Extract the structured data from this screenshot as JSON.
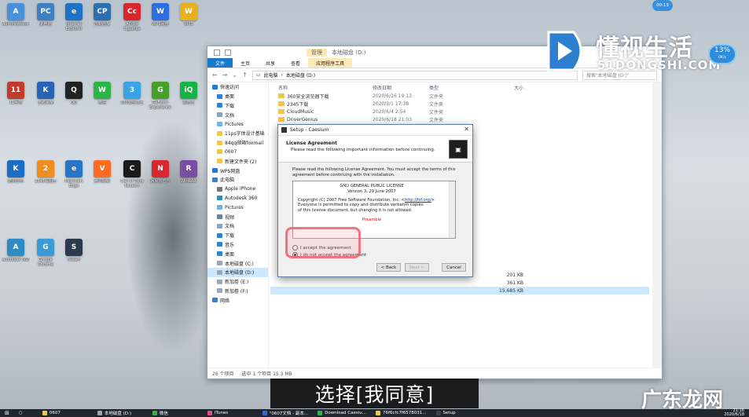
{
  "desktop": {
    "icons": [
      {
        "label": "Administrator",
        "icon": "user-folder-icon",
        "color": "#4a90d9",
        "text": "A"
      },
      {
        "label": "此电脑",
        "icon": "computer-icon",
        "color": "#3f7fc4",
        "text": "PC"
      },
      {
        "label": "Internet Explorer",
        "icon": "ie-icon",
        "color": "#1e73c8",
        "text": "e"
      },
      {
        "label": "控制面板",
        "icon": "control-panel-icon",
        "color": "#2e6fb0",
        "text": "CP"
      },
      {
        "label": "Adobe Creative Cloud",
        "icon": "adobe-cc-icon",
        "color": "#d9242c",
        "text": "Cc"
      },
      {
        "label": "WPS网盘",
        "icon": "wps-cloud-icon",
        "color": "#2d6fe0",
        "text": "W"
      },
      {
        "label": "WPS",
        "icon": "wps-icon",
        "color": "#e8b01c",
        "text": "W"
      },
      {
        "label": "11手游",
        "icon": "game-icon",
        "color": "#c23a2b",
        "text": "11"
      },
      {
        "label": "王者荣耀",
        "icon": "game-icon",
        "color": "#2764b6",
        "text": "K"
      },
      {
        "label": "QQ",
        "icon": "qq-icon",
        "color": "#222222",
        "text": "Q"
      },
      {
        "label": "微信",
        "icon": "wechat-icon",
        "color": "#2db545",
        "text": "W"
      },
      {
        "label": "360安全卫士",
        "icon": "security-icon",
        "color": "#3aa3e6",
        "text": "3"
      },
      {
        "label": "GeForce Experience",
        "icon": "nvidia-icon",
        "color": "#46a12b",
        "text": "G"
      },
      {
        "label": "爱奇艺",
        "icon": "iqiyi-icon",
        "color": "#17b445",
        "text": "iQ"
      },
      {
        "label": "酷狗音乐",
        "icon": "kugou-icon",
        "color": "#1a6ec6",
        "text": "K"
      },
      {
        "label": "2345看图王",
        "icon": "photo-icon",
        "color": "#ef8c22",
        "text": "2"
      },
      {
        "label": "Microsoft Edge",
        "icon": "edge-icon",
        "color": "#2874c6",
        "text": "e"
      },
      {
        "label": "腾讯视频",
        "icon": "video-icon",
        "color": "#ff6c21",
        "text": "V"
      },
      {
        "label": "Call of Duty Modern",
        "icon": "game-icon",
        "color": "#1b1b1b",
        "text": "C"
      },
      {
        "label": "网易云音乐",
        "icon": "netease-music-icon",
        "color": "#d8272e",
        "text": "N"
      },
      {
        "label": "WinRAR",
        "icon": "winrar-icon",
        "color": "#7a4da1",
        "text": "R"
      },
      {
        "label": "Autodesk 360",
        "icon": "autodesk-icon",
        "color": "#2d8cc4",
        "text": "A"
      },
      {
        "label": "Google Chrome",
        "icon": "chrome-icon",
        "color": "#3a9bd6",
        "text": "G"
      },
      {
        "label": "Steam",
        "icon": "steam-icon",
        "color": "#2b3a4d",
        "text": "S"
      }
    ]
  },
  "explorer": {
    "tabs": {
      "file": "文件",
      "home": "主页",
      "share": "共享",
      "view": "查看",
      "app_tools": "应用程序工具",
      "manage": "管理",
      "drive": "本地磁盘 (D:)"
    },
    "breadcrumb": {
      "root": "此电脑",
      "drive": "本地磁盘 (D:)"
    },
    "search_placeholder": "搜索\"本地磁盘 (D:)\"",
    "columns": {
      "name": "名称",
      "date": "修改日期",
      "type": "类型",
      "size": "大小"
    },
    "sidebar": [
      {
        "label": "快速访问",
        "color": "#1e7bd6",
        "sec": true
      },
      {
        "label": "桌面",
        "color": "#2b84d8"
      },
      {
        "label": "下载",
        "color": "#2b84d8"
      },
      {
        "label": "文档",
        "color": "#8aa4c0"
      },
      {
        "label": "Pictures",
        "color": "#6fb4e8"
      },
      {
        "label": "11ps字体设计基础",
        "color": "#f2c54b"
      },
      {
        "label": "84qq邮箱foxmail",
        "color": "#f2c54b"
      },
      {
        "label": "0607",
        "color": "#f2c54b"
      },
      {
        "label": "新建文件夹 (2)",
        "color": "#f2c54b"
      },
      {
        "label": "WPS网盘",
        "color": "#2d6fe0",
        "sec": true
      },
      {
        "label": "此电脑",
        "color": "#3f7fc4",
        "sec": true
      },
      {
        "label": "Apple iPhone",
        "color": "#777777"
      },
      {
        "label": "Autodesk 360",
        "color": "#2d8cc4"
      },
      {
        "label": "Pictures",
        "color": "#6fb4e8"
      },
      {
        "label": "视频",
        "color": "#6b7fa0"
      },
      {
        "label": "文档",
        "color": "#8aa4c0"
      },
      {
        "label": "下载",
        "color": "#2b84d8"
      },
      {
        "label": "音乐",
        "color": "#2b84d8"
      },
      {
        "label": "桌面",
        "color": "#2b84d8"
      },
      {
        "label": "本地磁盘 (C:)",
        "color": "#9aa7b4"
      },
      {
        "label": "本地磁盘 (D:)",
        "color": "#9aa7b4",
        "sel": true
      },
      {
        "label": "新加卷 (E:)",
        "color": "#9aa7b4"
      },
      {
        "label": "新加卷 (F:)",
        "color": "#9aa7b4"
      },
      {
        "label": "网络",
        "color": "#3f7fc4",
        "sec": true
      }
    ],
    "files": [
      {
        "name": "360安全浏览器下载",
        "date": "2020/6/16 19:13",
        "type": "文件夹",
        "size": ""
      },
      {
        "name": "2345下载",
        "date": "2020/3/1 17:38",
        "type": "文件夹",
        "size": ""
      },
      {
        "name": "CloudMusic",
        "date": "2020/6/4 2:54",
        "type": "文件夹",
        "size": ""
      },
      {
        "name": "DriverGenius",
        "date": "2020/6/18 21:03",
        "type": "文件夹",
        "size": ""
      }
    ],
    "hidden_rows": [
      {
        "size": "201 KB"
      },
      {
        "size": "361 KB"
      },
      {
        "size": "15,685 KB",
        "sel": true
      }
    ],
    "status": {
      "count": "26 个项目",
      "selected": "选中 1 个项目 15.3 MB"
    }
  },
  "setup": {
    "title": "Setup - Caesium",
    "close_glyph": "✕",
    "header_title": "License Agreement",
    "header_sub": "Please read the following important information before continuing.",
    "desc": "Please read the following License Agreement. You must accept the terms of this agreement before continuing with the installation.",
    "license_lines": {
      "l1": "GNU GENERAL PUBLIC LICENSE",
      "l2": "Version 3, 29 June 2007",
      "l3a": "Copyright (C) 2007 Free Software Foundation, Inc. <",
      "l3link": "http://fsf.org/",
      "l3b": ">",
      "l4": "Everyone is permitted to copy and distribute verbatim copies",
      "l5": "of this license document, but changing it is not allowed.",
      "preamble": "Preamble"
    },
    "radio_accept": "I accept the agreement",
    "radio_decline": "I do not accept the agreement",
    "btn_back": "< Back",
    "btn_next": "Next >",
    "btn_cancel": "Cancel"
  },
  "watermark": {
    "brand_cn": "懂视生活",
    "brand_en": "51DONGSHI.COM",
    "bottom_brand": "广东龙网"
  },
  "badges": {
    "percent": "13%",
    "percent_sub": "0K/s",
    "time": "00:13"
  },
  "subtitle": "选择[我同意]",
  "taskbar": {
    "items": [
      {
        "label": "0607",
        "color": "#f2c54b"
      },
      {
        "label": "本地磁盘 (D:)",
        "color": "#9aa7b4"
      },
      {
        "label": "微信",
        "color": "#2db545"
      },
      {
        "label": "iTunes",
        "color": "#e04d8c"
      },
      {
        "label": "\"0607文档 - 副本...",
        "color": "#2d6fe0"
      },
      {
        "label": "Download Caesiu...",
        "color": "#2db545"
      },
      {
        "label": "76f6cfc7f6578031...",
        "color": "#f2c54b"
      },
      {
        "label": "Setup",
        "color": "#444444"
      }
    ],
    "time": "21:16",
    "date": "2020/6/18"
  }
}
